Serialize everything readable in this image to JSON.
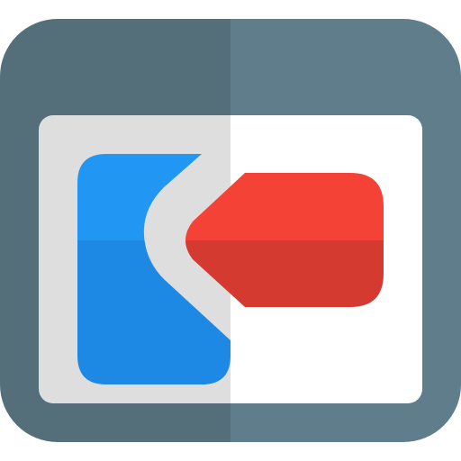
{
  "icon": {
    "name": "exit-window-icon",
    "colors": {
      "frame_dark": "#546e7a",
      "frame_light": "#607d8b",
      "pane_gray": "#dedede",
      "pane_white": "#ffffff",
      "door_blue": "#2196f3",
      "door_blue_dark": "#1e88e5",
      "arrow_red": "#f44336",
      "arrow_red_dark": "#d43a2f"
    }
  }
}
